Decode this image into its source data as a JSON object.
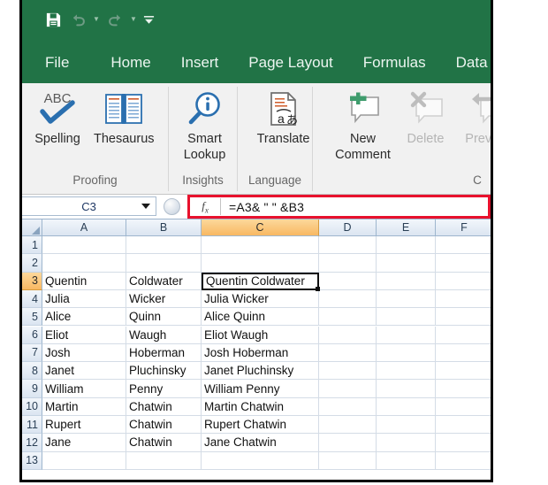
{
  "window": {
    "theme_color": "#217346",
    "ribbon_bg": "#f1f1f1"
  },
  "quick_access": {
    "items": [
      {
        "name": "save-icon",
        "label": "Save"
      },
      {
        "name": "undo-icon",
        "label": "Undo"
      },
      {
        "name": "redo-icon",
        "label": "Redo"
      },
      {
        "name": "customize-qat-icon",
        "label": "Customize Quick Access Toolbar"
      }
    ]
  },
  "tabs": [
    {
      "label": "File"
    },
    {
      "label": "Home"
    },
    {
      "label": "Insert"
    },
    {
      "label": "Page Layout"
    },
    {
      "label": "Formulas"
    },
    {
      "label": "Data"
    }
  ],
  "ribbon": {
    "groups": [
      {
        "name": "Proofing",
        "items": [
          {
            "label": "Spelling",
            "icon": "spelling-abc-check-icon",
            "disabled": false
          },
          {
            "label": "Thesaurus",
            "icon": "thesaurus-book-icon",
            "disabled": false
          }
        ]
      },
      {
        "name": "Insights",
        "items": [
          {
            "label": "Smart Lookup",
            "icon": "smart-lookup-magnifier-icon",
            "disabled": false
          }
        ]
      },
      {
        "name": "Language",
        "items": [
          {
            "label": "Translate",
            "icon": "translate-page-icon",
            "disabled": false
          }
        ]
      },
      {
        "name": "C",
        "items": [
          {
            "label": "New Comment",
            "icon": "new-comment-icon",
            "disabled": false
          },
          {
            "label": "Delete",
            "icon": "delete-comment-icon",
            "disabled": true
          },
          {
            "label": "Previous",
            "icon": "previous-comment-icon",
            "disabled": true
          }
        ]
      }
    ]
  },
  "formula_bar": {
    "name_box_value": "C3",
    "fx_label": "fx",
    "formula": "=A3& \" \" &B3",
    "highlight_color": "#e8112d"
  },
  "sheet": {
    "columns": [
      "A",
      "B",
      "C",
      "D",
      "E",
      "F"
    ],
    "selected_column": "C",
    "selected_row": 3,
    "active_cell": "C3",
    "rows": [
      {
        "n": 1,
        "A": "",
        "B": "",
        "C": ""
      },
      {
        "n": 2,
        "A": "",
        "B": "",
        "C": ""
      },
      {
        "n": 3,
        "A": "Quentin",
        "B": "Coldwater",
        "C": "Quentin Coldwater"
      },
      {
        "n": 4,
        "A": "Julia",
        "B": "Wicker",
        "C": "Julia Wicker"
      },
      {
        "n": 5,
        "A": "Alice",
        "B": "Quinn",
        "C": "Alice Quinn"
      },
      {
        "n": 6,
        "A": "Eliot",
        "B": "Waugh",
        "C": "Eliot Waugh"
      },
      {
        "n": 7,
        "A": "Josh",
        "B": "Hoberman",
        "C": "Josh Hoberman"
      },
      {
        "n": 8,
        "A": "Janet",
        "B": "Pluchinsky",
        "C": "Janet Pluchinsky"
      },
      {
        "n": 9,
        "A": "William",
        "B": "Penny",
        "C": "William Penny"
      },
      {
        "n": 10,
        "A": "Martin",
        "B": "Chatwin",
        "C": "Martin Chatwin"
      },
      {
        "n": 11,
        "A": "Rupert",
        "B": "Chatwin",
        "C": "Rupert Chatwin"
      },
      {
        "n": 12,
        "A": "Jane",
        "B": "Chatwin",
        "C": "Jane Chatwin"
      },
      {
        "n": 13,
        "A": "",
        "B": "",
        "C": ""
      }
    ]
  }
}
